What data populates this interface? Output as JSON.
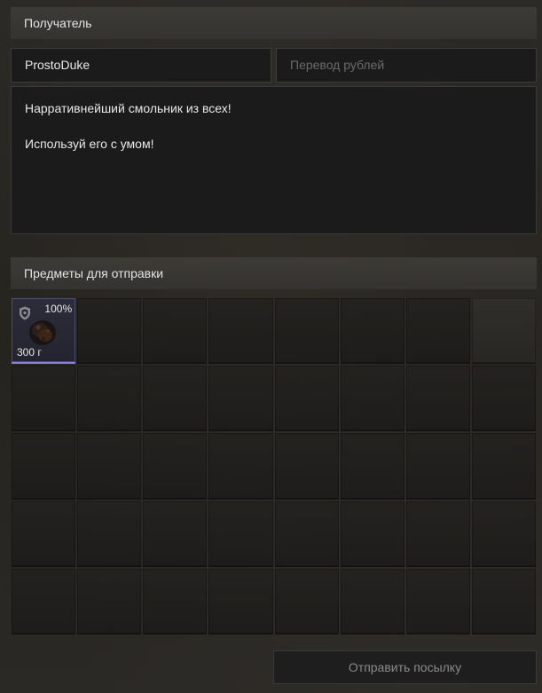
{
  "recipient_section": {
    "title": "Получатель",
    "recipient_name": "ProstoDuke",
    "transfer_placeholder": "Перевод рублей",
    "message_lines": [
      "Нарративнейший смольник из всех!",
      "",
      "Используй его с умом!"
    ]
  },
  "items_section": {
    "title": "Предметы для отправки",
    "grid": {
      "columns": 8,
      "rows": 5
    },
    "slots": [
      {
        "icon": "shield-icon",
        "percent": "100%",
        "weight": "300 г",
        "image": "item-image"
      }
    ]
  },
  "send_button_label": "Отправить посылку",
  "colors": {
    "selected_border": "#8b7fe0",
    "panel_header": "#3d3b36",
    "field_bg": "#1b1b1b"
  }
}
